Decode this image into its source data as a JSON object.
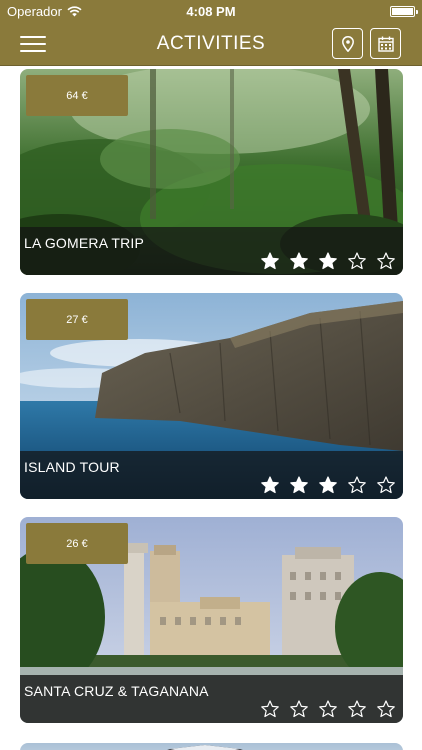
{
  "status_bar": {
    "carrier": "Operador",
    "time": "4:08 PM",
    "battery_level": 1.0
  },
  "nav": {
    "title": "ACTIVITIES",
    "menu_icon": "hamburger-icon",
    "map_icon": "map-pin-icon",
    "calendar_icon": "calendar-icon"
  },
  "activities": [
    {
      "name": "LA GOMERA TRIP",
      "price": "64 €",
      "rating": 3,
      "rating_max": 5
    },
    {
      "name": "ISLAND TOUR",
      "price": "27 €",
      "rating": 3,
      "rating_max": 5
    },
    {
      "name": "SANTA CRUZ & TAGANANA",
      "price": "26 €",
      "rating": 0,
      "rating_max": 5
    }
  ],
  "colors": {
    "brand": "#8a7a3b",
    "caption_overlay": "#141414",
    "text": "#ffffff"
  }
}
